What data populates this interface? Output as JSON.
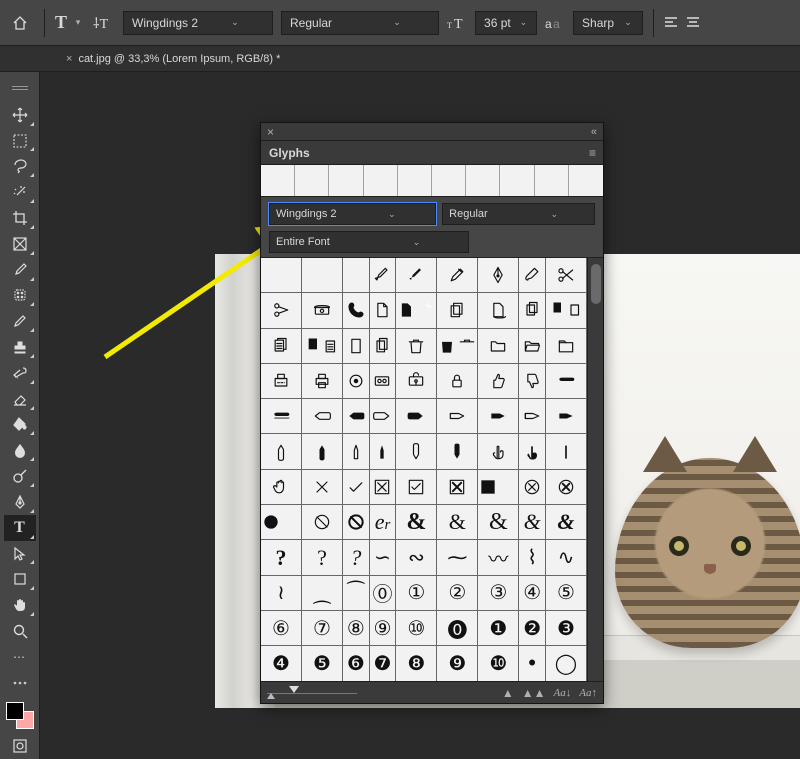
{
  "options_bar": {
    "font_family": "Wingdings 2",
    "font_style": "Regular",
    "font_size": "36 pt",
    "antialias": "Sharp"
  },
  "tab": {
    "title": "cat.jpg @ 33,3% (Lorem Ipsum, RGB/8) *"
  },
  "toolbar": {
    "tools": [
      "move",
      "artboard",
      "marquee",
      "lasso",
      "magic-wand",
      "crop",
      "frame",
      "eyedropper",
      "patch",
      "pencil",
      "clone-stamp",
      "history-brush",
      "eraser",
      "paint-bucket",
      "blur",
      "dodge",
      "pen",
      "type",
      "path-select",
      "rectangle",
      "hand",
      "zoom",
      "edit-toolbar",
      "more"
    ],
    "active_tool": "type",
    "swatch_fg": "#000000",
    "swatch_bg": "#fda7a7"
  },
  "glyphs": {
    "panel_title": "Glyphs",
    "font_family": "Wingdings 2",
    "font_style": "Regular",
    "subset": "Entire Font",
    "footer": {
      "size_down_label": "Aa↓",
      "size_up_label": "Aa↑"
    },
    "glyph_labels": [
      "",
      "",
      "",
      "pen",
      "pen-fill",
      "pencil",
      "nib",
      "brush",
      "scissors-open",
      "scissors",
      "telephone",
      "handset",
      "page",
      "page-fill",
      "pages-3",
      "page-shadow",
      "pages-2",
      "pages-2-fill",
      "docs",
      "docs-fill",
      "doc-plain",
      "docs-plain",
      "trash",
      "trash-fill",
      "folder",
      "folder-open",
      "folder-tab",
      "fax",
      "printer",
      "disc",
      "tape",
      "lock-key",
      "lock",
      "thumbs-up",
      "thumbs-down",
      "hand-flat",
      "hand-flat-fill",
      "hand-point-l",
      "hand-point-l-fill",
      "hand-point-r",
      "hand-point-r-fill",
      "hand-point-r2",
      "hand-point-r2-fill",
      "hand-point-r3",
      "hand-point-r3-fill",
      "hand-up",
      "hand-up-fill",
      "hand-up2",
      "hand-up2-fill",
      "hand-down",
      "hand-down-fill",
      "finger-up",
      "finger-up-fill",
      "finger-up2",
      "hand-stop",
      "x-thin",
      "check",
      "box-x",
      "box-check",
      "box-x-bold",
      "box-x-bold2",
      "circle-x",
      "circle-x2",
      "circle-x3",
      "prohibit",
      "prohibit-bold",
      "et",
      "ampersand",
      "amp-serif",
      "amp-script",
      "amp-italic",
      "amp-italic2",
      "question1",
      "question2",
      "question3",
      "flourish1",
      "flourish2",
      "flourish3",
      "flourish4",
      "flourish5",
      "flourish6",
      "flourish7",
      "flourish8",
      "flourish9",
      "circled-0",
      "circled-1",
      "circled-2",
      "circled-3",
      "circled-4",
      "circled-5",
      "circled-6",
      "circled-7",
      "circled-8",
      "circled-9",
      "circled-10",
      "neg-0",
      "neg-1",
      "neg-2",
      "neg-3",
      "neg-4",
      "neg-5",
      "neg-6",
      "neg-7",
      "neg-8",
      "neg-9",
      "neg-10",
      "bullet",
      "ring"
    ]
  }
}
